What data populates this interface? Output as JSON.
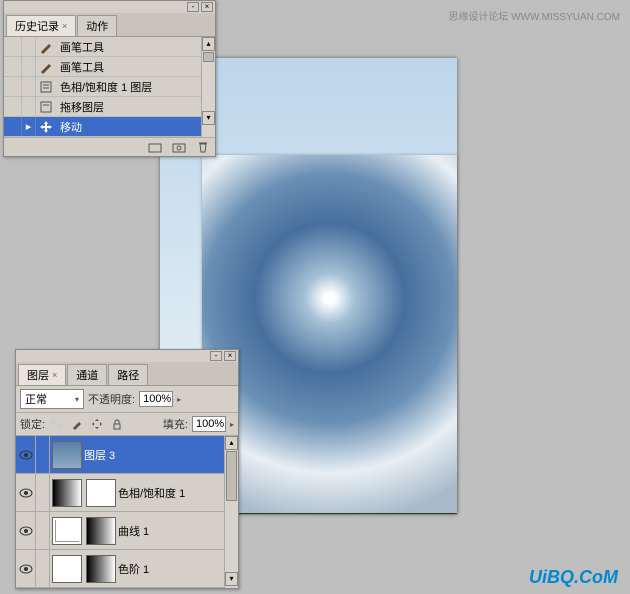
{
  "watermarks": {
    "top": "思缘设计论坛 WWW.MISSYUAN.COM",
    "bottom": "UiBQ.CoM"
  },
  "history": {
    "tabs": [
      {
        "label": "历史记录",
        "active": true
      },
      {
        "label": "动作",
        "active": false
      }
    ],
    "items": [
      {
        "icon": "brush",
        "label": "画笔工具",
        "sel": false
      },
      {
        "icon": "brush",
        "label": "画笔工具",
        "sel": false
      },
      {
        "icon": "adjust",
        "label": "色相/饱和度 1 图层",
        "sel": false
      },
      {
        "icon": "adjust",
        "label": "拖移图层",
        "sel": false
      },
      {
        "icon": "move",
        "label": "移动",
        "sel": true
      }
    ]
  },
  "layers": {
    "tabs": [
      {
        "label": "图层",
        "active": true
      },
      {
        "label": "通道",
        "active": false
      },
      {
        "label": "路径",
        "active": false
      }
    ],
    "blend": {
      "label": "正常"
    },
    "opacity": {
      "label": "不透明度:",
      "value": "100%"
    },
    "lock": {
      "label": "锁定:"
    },
    "fill": {
      "label": "填充:",
      "value": "100%"
    },
    "items": [
      {
        "name": "图层 3",
        "kind": "sky",
        "sel": true
      },
      {
        "name": "色相/饱和度 1",
        "kind": "hsl",
        "sel": false
      },
      {
        "name": "曲线 1",
        "kind": "curve",
        "sel": false
      },
      {
        "name": "色阶 1",
        "kind": "levels",
        "sel": false
      }
    ]
  }
}
